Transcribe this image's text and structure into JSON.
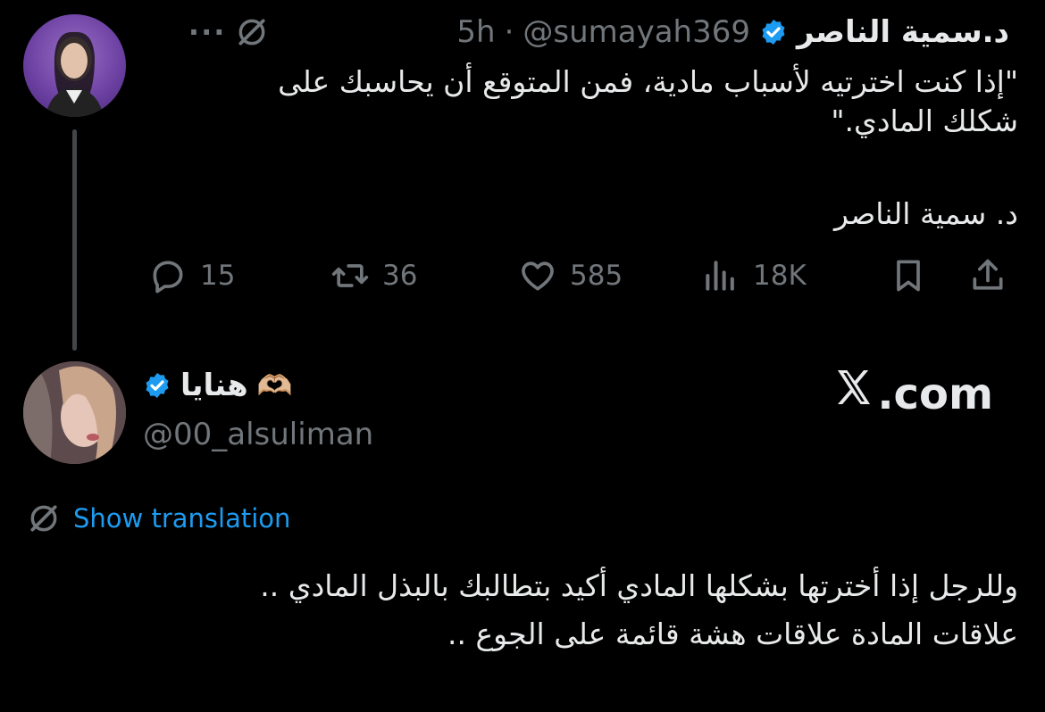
{
  "tweet1": {
    "author_name": "د.سمية الناصر",
    "handle": "@sumayah369",
    "separator": "·",
    "time": "5h",
    "more": "···",
    "body": "\"إذا كنت اخترتيه لأسباب مادية، فمن المتوقع أن يحاسبك على\nشكلك المادي.\"",
    "signature": "د. سمية الناصر",
    "stats": {
      "replies": "15",
      "reposts": "36",
      "likes": "585",
      "views": "18K"
    }
  },
  "tweet2": {
    "author_name": "هنايا",
    "author_emoji": "🫶🏼",
    "handle": "@00_alsuliman",
    "show_translation": "Show translation",
    "body": "وللرجل إذا أخترتها بشكلها المادي أكيد بتطالبك بالبذل المادي ..\nعلاقات المادة علاقات هشة قائمة على  الجوع .."
  },
  "watermark": ".com",
  "colors": {
    "background": "#000000",
    "text": "#e7e9ea",
    "muted": "#71767b",
    "accent": "#1d9bf0",
    "verified": "#1d9bf0"
  },
  "icons": [
    "grok-icon",
    "more-icon",
    "verified-icon",
    "reply-icon",
    "repost-icon",
    "like-icon",
    "views-icon",
    "bookmark-icon",
    "share-icon",
    "globe-icon",
    "x-logo-icon"
  ]
}
